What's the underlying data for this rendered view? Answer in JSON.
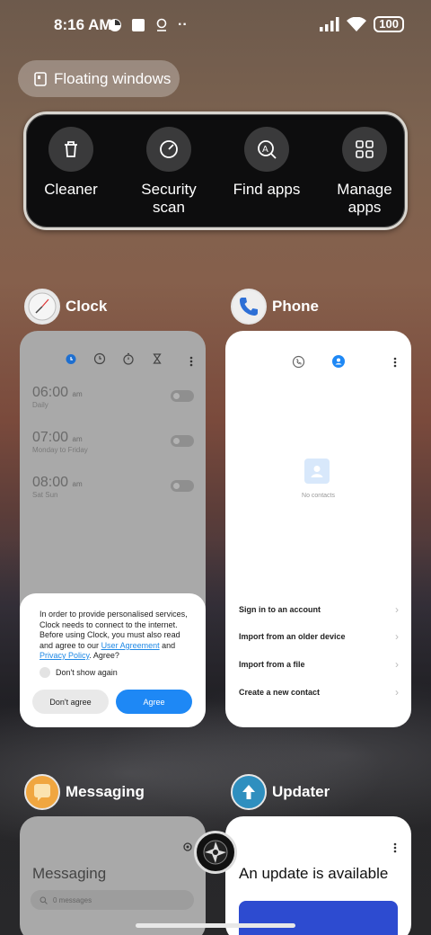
{
  "status_bar": {
    "time": "8:16 AM",
    "battery": "100",
    "more": "··"
  },
  "floating_windows": {
    "label": "Floating windows"
  },
  "tools": [
    {
      "label": "Cleaner",
      "icon": "trash-icon"
    },
    {
      "label": "Security scan",
      "icon": "security-scan-icon"
    },
    {
      "label": "Find apps",
      "icon": "find-apps-icon"
    },
    {
      "label": "Manage apps",
      "icon": "grid-icon"
    }
  ],
  "clock": {
    "app_name": "Clock",
    "alarms": [
      {
        "time": "06:00",
        "ampm": "am",
        "sub": "Daily"
      },
      {
        "time": "07:00",
        "ampm": "am",
        "sub": "Monday to Friday"
      },
      {
        "time": "08:00",
        "ampm": "am",
        "sub": "Sat Sun"
      }
    ],
    "dialog": {
      "text_before": "In order to provide personalised services, Clock needs to connect to the internet. Before using Clock, you must also read and agree to our ",
      "link1": "User Agreement",
      "text_mid": " and ",
      "link2": "Privacy Policy",
      "text_after": ". Agree?",
      "checkbox_label": "Don't show again",
      "disagree": "Don't agree",
      "agree": "Agree"
    }
  },
  "phone": {
    "app_name": "Phone",
    "empty_text": "No contacts",
    "actions": [
      "Sign in to an account",
      "Import from an older device",
      "Import from a file",
      "Create a new contact"
    ]
  },
  "messaging": {
    "app_name": "Messaging",
    "title": "Messaging",
    "search_placeholder": "0 messages"
  },
  "updater": {
    "app_name": "Updater",
    "title": "An update is available"
  },
  "colors": {
    "accent": "#1e88f5"
  }
}
